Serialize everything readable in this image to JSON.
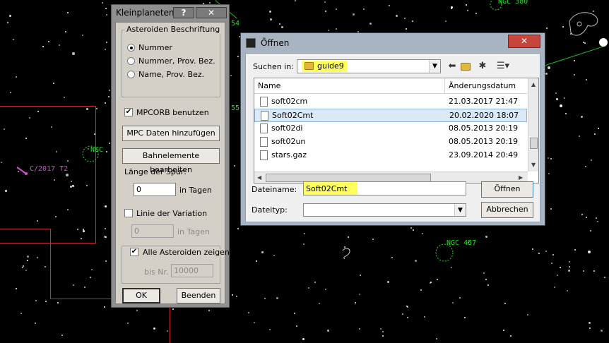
{
  "sky": {
    "labels": [
      "NGC 380",
      "NGC",
      "NGC 457",
      "54",
      "55"
    ],
    "comet": "C/2017 T2"
  },
  "kleinplaneten": {
    "title": "Kleinplaneten",
    "help": "?",
    "close": "✕",
    "group_title": "Asteroiden Beschriftung",
    "radios": [
      "Nummer",
      "Nummer, Prov. Bez.",
      "Name, Prov. Bez."
    ],
    "selected_radio": "Nummer",
    "mpcorb_label": "MPCORB benutzen",
    "mpcorb_checked": "✔",
    "mpc_button": "MPC Daten hinzufügen",
    "bahn_button": "Bahnelemente bearbeiten",
    "spur_label": "Länge der Spur:",
    "spur_value": "0",
    "spur_unit": "in Tagen",
    "variation_label": "Linie der Variation",
    "variation_value": "0",
    "variation_unit": "in Tagen",
    "alle_label": "Alle Asteroiden zeigen",
    "alle_checked": "✔",
    "bis_label": "bis Nr.",
    "bis_value": "10000",
    "ok": "OK",
    "beenden": "Beenden"
  },
  "oeffnen": {
    "title": "Öffnen",
    "close": "✕",
    "suchen_label": "Suchen in:",
    "folder": "guide9",
    "icons": [
      "back-icon",
      "up-folder-icon",
      "new-folder-icon",
      "view-menu-icon"
    ],
    "columns": [
      "Name",
      "Änderungsdatum"
    ],
    "files": [
      {
        "name": "soft02cm",
        "date": "21.03.2017 21:47"
      },
      {
        "name": "Soft02Cmt",
        "date": "20.02.2020 18:07"
      },
      {
        "name": "soft02di",
        "date": "08.05.2013 20:19"
      },
      {
        "name": "soft02un",
        "date": "08.05.2013 20:19"
      },
      {
        "name": "stars.gaz",
        "date": "23.09.2014 20:49"
      }
    ],
    "selected_file": "Soft02Cmt",
    "dateiname_label": "Dateiname:",
    "dateiname_value": "Soft02Cmt",
    "dateityp_label": "Dateityp:",
    "dateityp_value": "",
    "open_button": "Öffnen",
    "cancel_button": "Abbrechen"
  },
  "colors": {
    "highlight": "#ffff60",
    "sky_label": "#19e619",
    "comet": "#d050d0",
    "boundary": "#c0303a"
  }
}
